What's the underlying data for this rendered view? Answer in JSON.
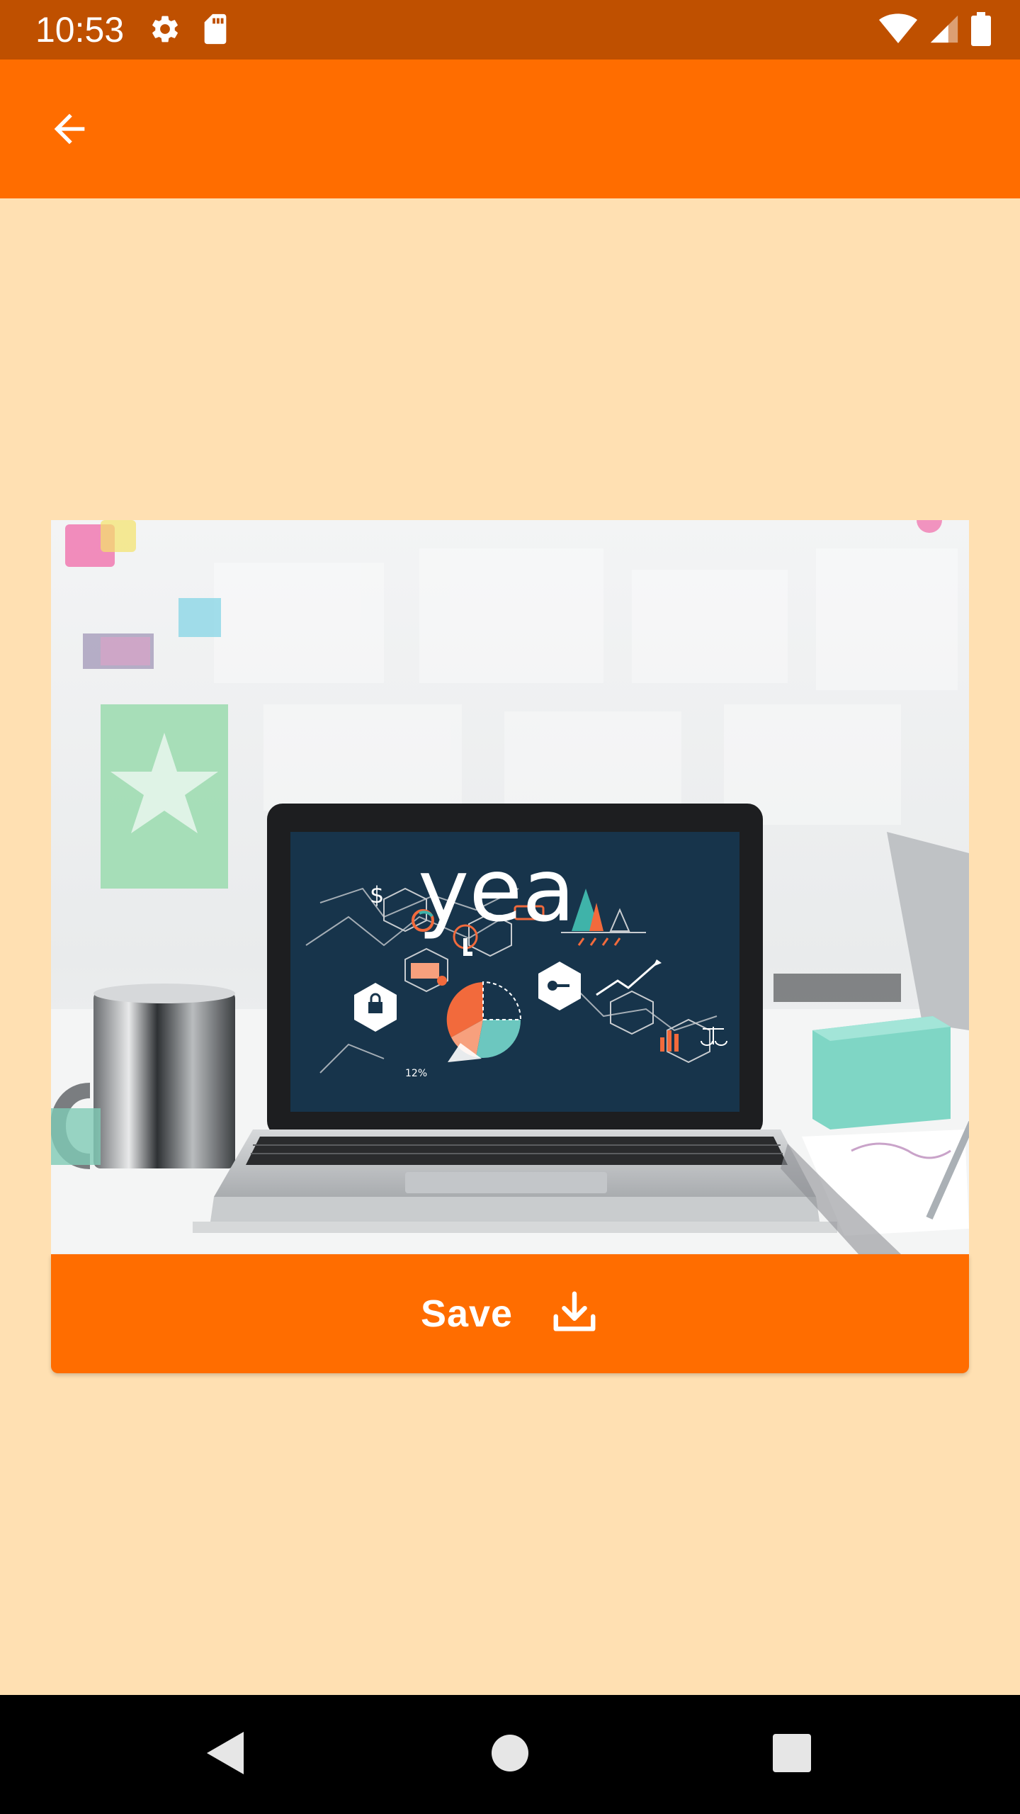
{
  "status_bar": {
    "time": "10:53",
    "icons": [
      "gear-icon",
      "sd-card-icon",
      "wifi-icon",
      "cell-signal-icon",
      "battery-icon"
    ]
  },
  "app_bar": {
    "back_icon": "arrow-back-icon",
    "background_color": "#FF6D00"
  },
  "preview": {
    "screen_text": "yea",
    "screen_small_text": "12%"
  },
  "save_button": {
    "label": "Save",
    "icon": "download-icon"
  },
  "colors": {
    "status_bar": "#BF5000",
    "accent": "#FF6D00",
    "page_background": "#FFE0B2",
    "nav_bar": "#000000"
  },
  "nav_bar": {
    "icons": [
      "nav-back-icon",
      "nav-home-icon",
      "nav-recents-icon"
    ]
  }
}
